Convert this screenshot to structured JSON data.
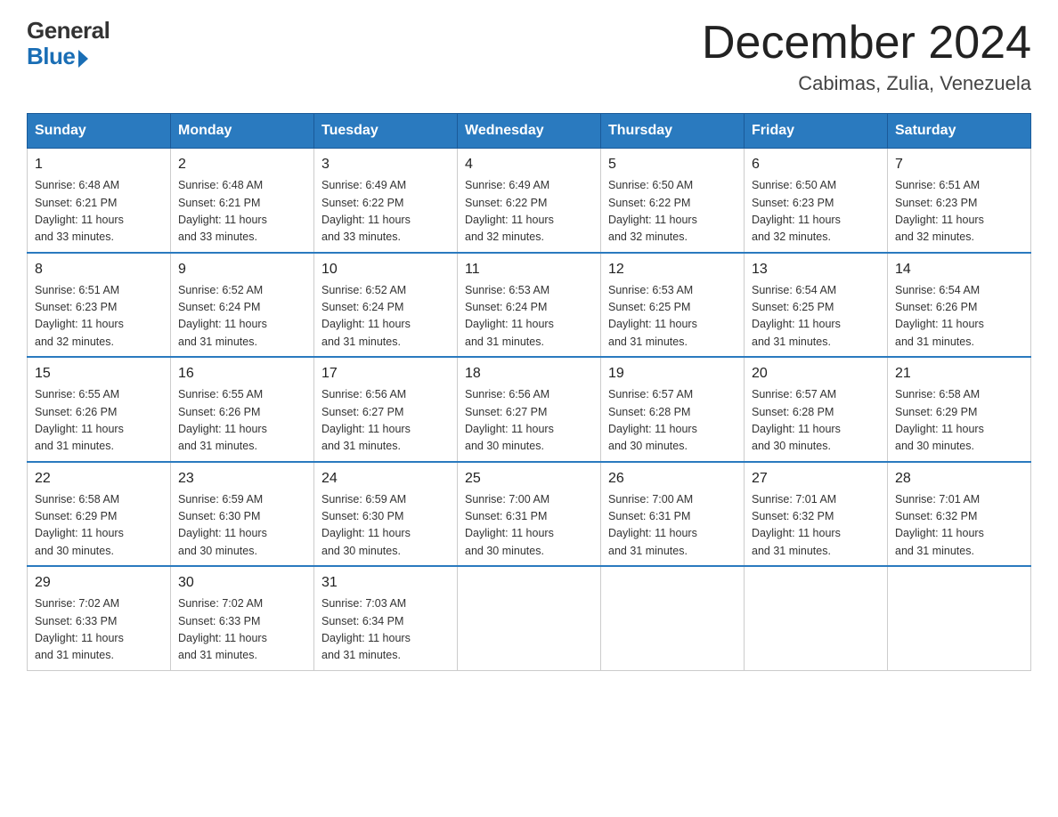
{
  "logo": {
    "general": "General",
    "blue": "Blue"
  },
  "title": "December 2024",
  "subtitle": "Cabimas, Zulia, Venezuela",
  "days": [
    "Sunday",
    "Monday",
    "Tuesday",
    "Wednesday",
    "Thursday",
    "Friday",
    "Saturday"
  ],
  "weeks": [
    [
      {
        "num": "1",
        "info": "Sunrise: 6:48 AM\nSunset: 6:21 PM\nDaylight: 11 hours\nand 33 minutes."
      },
      {
        "num": "2",
        "info": "Sunrise: 6:48 AM\nSunset: 6:21 PM\nDaylight: 11 hours\nand 33 minutes."
      },
      {
        "num": "3",
        "info": "Sunrise: 6:49 AM\nSunset: 6:22 PM\nDaylight: 11 hours\nand 33 minutes."
      },
      {
        "num": "4",
        "info": "Sunrise: 6:49 AM\nSunset: 6:22 PM\nDaylight: 11 hours\nand 32 minutes."
      },
      {
        "num": "5",
        "info": "Sunrise: 6:50 AM\nSunset: 6:22 PM\nDaylight: 11 hours\nand 32 minutes."
      },
      {
        "num": "6",
        "info": "Sunrise: 6:50 AM\nSunset: 6:23 PM\nDaylight: 11 hours\nand 32 minutes."
      },
      {
        "num": "7",
        "info": "Sunrise: 6:51 AM\nSunset: 6:23 PM\nDaylight: 11 hours\nand 32 minutes."
      }
    ],
    [
      {
        "num": "8",
        "info": "Sunrise: 6:51 AM\nSunset: 6:23 PM\nDaylight: 11 hours\nand 32 minutes."
      },
      {
        "num": "9",
        "info": "Sunrise: 6:52 AM\nSunset: 6:24 PM\nDaylight: 11 hours\nand 31 minutes."
      },
      {
        "num": "10",
        "info": "Sunrise: 6:52 AM\nSunset: 6:24 PM\nDaylight: 11 hours\nand 31 minutes."
      },
      {
        "num": "11",
        "info": "Sunrise: 6:53 AM\nSunset: 6:24 PM\nDaylight: 11 hours\nand 31 minutes."
      },
      {
        "num": "12",
        "info": "Sunrise: 6:53 AM\nSunset: 6:25 PM\nDaylight: 11 hours\nand 31 minutes."
      },
      {
        "num": "13",
        "info": "Sunrise: 6:54 AM\nSunset: 6:25 PM\nDaylight: 11 hours\nand 31 minutes."
      },
      {
        "num": "14",
        "info": "Sunrise: 6:54 AM\nSunset: 6:26 PM\nDaylight: 11 hours\nand 31 minutes."
      }
    ],
    [
      {
        "num": "15",
        "info": "Sunrise: 6:55 AM\nSunset: 6:26 PM\nDaylight: 11 hours\nand 31 minutes."
      },
      {
        "num": "16",
        "info": "Sunrise: 6:55 AM\nSunset: 6:26 PM\nDaylight: 11 hours\nand 31 minutes."
      },
      {
        "num": "17",
        "info": "Sunrise: 6:56 AM\nSunset: 6:27 PM\nDaylight: 11 hours\nand 31 minutes."
      },
      {
        "num": "18",
        "info": "Sunrise: 6:56 AM\nSunset: 6:27 PM\nDaylight: 11 hours\nand 30 minutes."
      },
      {
        "num": "19",
        "info": "Sunrise: 6:57 AM\nSunset: 6:28 PM\nDaylight: 11 hours\nand 30 minutes."
      },
      {
        "num": "20",
        "info": "Sunrise: 6:57 AM\nSunset: 6:28 PM\nDaylight: 11 hours\nand 30 minutes."
      },
      {
        "num": "21",
        "info": "Sunrise: 6:58 AM\nSunset: 6:29 PM\nDaylight: 11 hours\nand 30 minutes."
      }
    ],
    [
      {
        "num": "22",
        "info": "Sunrise: 6:58 AM\nSunset: 6:29 PM\nDaylight: 11 hours\nand 30 minutes."
      },
      {
        "num": "23",
        "info": "Sunrise: 6:59 AM\nSunset: 6:30 PM\nDaylight: 11 hours\nand 30 minutes."
      },
      {
        "num": "24",
        "info": "Sunrise: 6:59 AM\nSunset: 6:30 PM\nDaylight: 11 hours\nand 30 minutes."
      },
      {
        "num": "25",
        "info": "Sunrise: 7:00 AM\nSunset: 6:31 PM\nDaylight: 11 hours\nand 30 minutes."
      },
      {
        "num": "26",
        "info": "Sunrise: 7:00 AM\nSunset: 6:31 PM\nDaylight: 11 hours\nand 31 minutes."
      },
      {
        "num": "27",
        "info": "Sunrise: 7:01 AM\nSunset: 6:32 PM\nDaylight: 11 hours\nand 31 minutes."
      },
      {
        "num": "28",
        "info": "Sunrise: 7:01 AM\nSunset: 6:32 PM\nDaylight: 11 hours\nand 31 minutes."
      }
    ],
    [
      {
        "num": "29",
        "info": "Sunrise: 7:02 AM\nSunset: 6:33 PM\nDaylight: 11 hours\nand 31 minutes."
      },
      {
        "num": "30",
        "info": "Sunrise: 7:02 AM\nSunset: 6:33 PM\nDaylight: 11 hours\nand 31 minutes."
      },
      {
        "num": "31",
        "info": "Sunrise: 7:03 AM\nSunset: 6:34 PM\nDaylight: 11 hours\nand 31 minutes."
      },
      null,
      null,
      null,
      null
    ]
  ]
}
